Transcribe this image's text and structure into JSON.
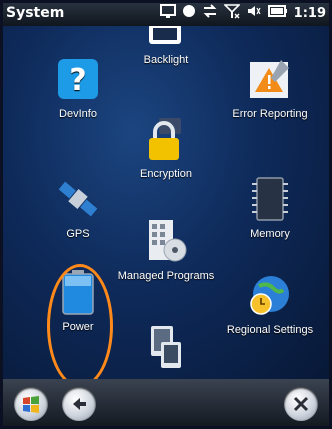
{
  "statusbar": {
    "title": "System",
    "time": "1:19"
  },
  "apps": [
    {
      "label": "Backlight"
    },
    {
      "label": "DevInfo"
    },
    {
      "label": "Error Reporting"
    },
    {
      "label": "Encryption"
    },
    {
      "label": "GPS"
    },
    {
      "label": "Memory"
    },
    {
      "label": "Managed Programs"
    },
    {
      "label": "Power"
    },
    {
      "label": "Regional Settings"
    }
  ],
  "bottombar": {
    "start_icon": "windows-flag-icon",
    "back_icon": "back-arrow-icon",
    "close_icon": "close-icon"
  }
}
